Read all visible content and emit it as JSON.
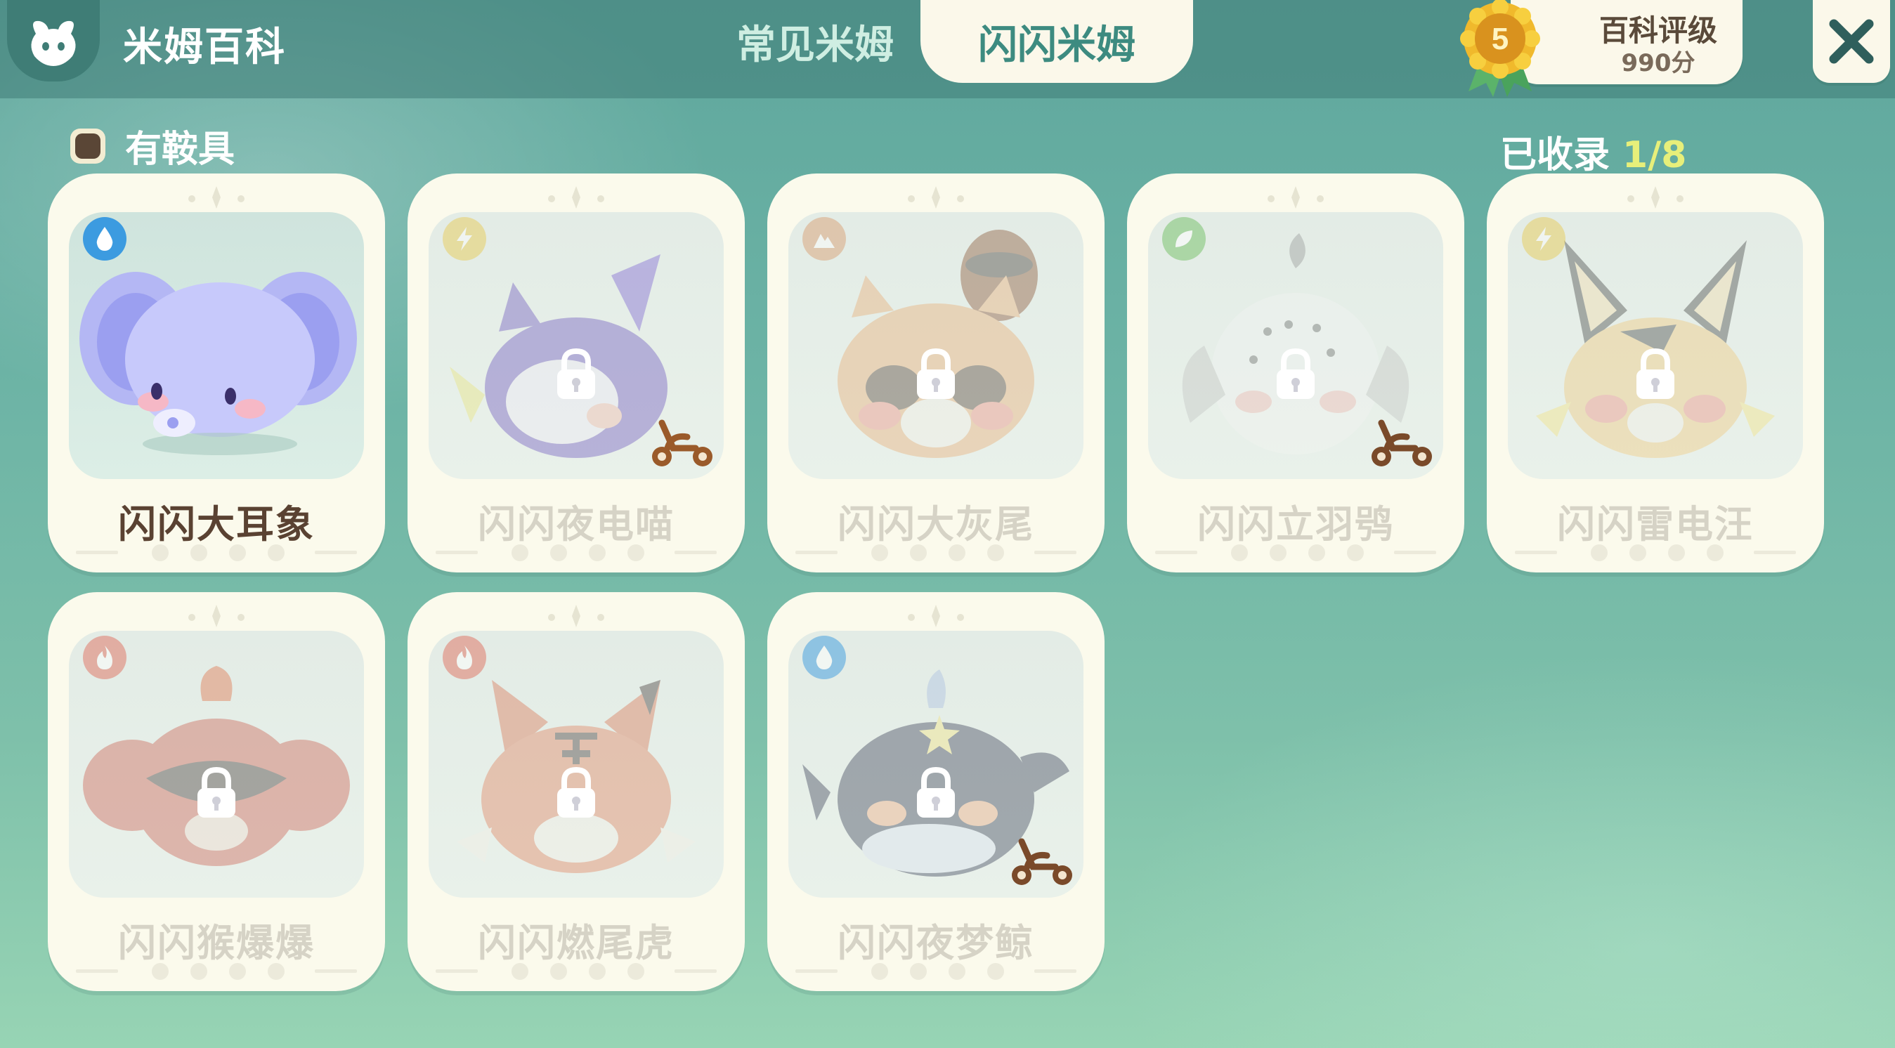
{
  "header": {
    "app_title": "米姆百科",
    "tabs": [
      {
        "label": "常见米姆",
        "active": false
      },
      {
        "label": "闪闪米姆",
        "active": true
      }
    ],
    "rating": {
      "title": "百科评级",
      "score": "990分",
      "level": "5"
    }
  },
  "filter": {
    "label": "有鞍具",
    "checked": true
  },
  "collection": {
    "label": "已收录",
    "count": "1/8"
  },
  "cards": [
    {
      "name": "闪闪大耳象",
      "element": "water",
      "element_color": "#3c9be0",
      "locked": false,
      "rideable": false
    },
    {
      "name": "闪闪夜电喵",
      "element": "electric",
      "element_color": "#e8c84a",
      "locked": true,
      "rideable": true
    },
    {
      "name": "闪闪大灰尾",
      "element": "ground",
      "element_color": "#d89a6a",
      "locked": true,
      "rideable": false
    },
    {
      "name": "闪闪立羽鸮",
      "element": "grass",
      "element_color": "#7dc470",
      "locked": true,
      "rideable": true
    },
    {
      "name": "闪闪雷电汪",
      "element": "electric",
      "element_color": "#e8c84a",
      "locked": true,
      "rideable": false
    },
    {
      "name": "闪闪猴爆爆",
      "element": "fire",
      "element_color": "#e07060",
      "locked": true,
      "rideable": false
    },
    {
      "name": "闪闪燃尾虎",
      "element": "fire",
      "element_color": "#e07060",
      "locked": true,
      "rideable": false
    },
    {
      "name": "闪闪夜梦鲸",
      "element": "water",
      "element_color": "#3c9be0",
      "locked": true,
      "rideable": true
    }
  ],
  "colors": {
    "accent": "#3d8b80",
    "cream": "#fbf8ea",
    "collected_count": "#e7ef7a"
  }
}
